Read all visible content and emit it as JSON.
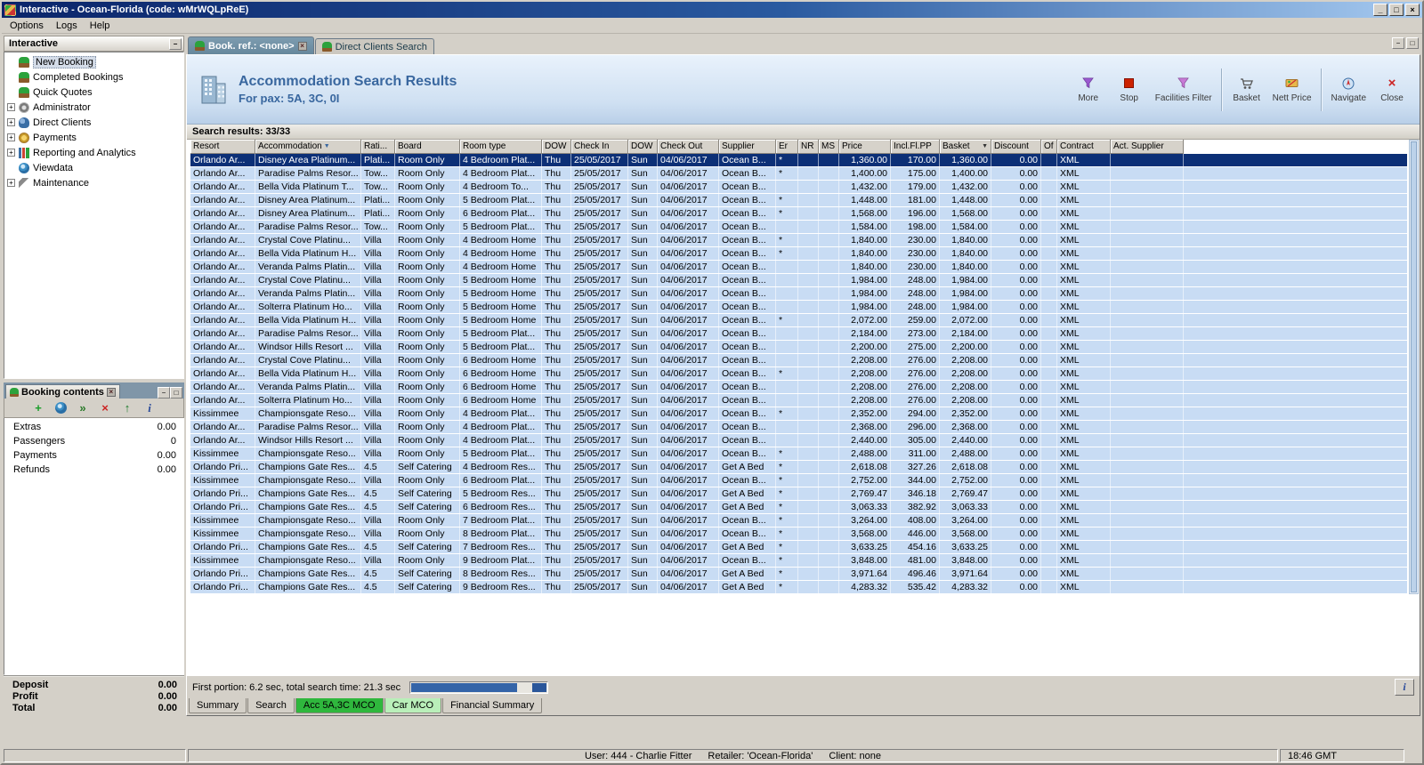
{
  "window": {
    "title": "Interactive - Ocean-Florida (code: wMrWQLpReE)",
    "menu": [
      "Options",
      "Logs",
      "Help"
    ],
    "buttons": {
      "minimize": "_",
      "maximize": "□",
      "close": "×"
    }
  },
  "sidebar": {
    "title": "Interactive",
    "items": [
      {
        "label": "New Booking",
        "icon": "palm-icon",
        "expandable": false,
        "selected": true
      },
      {
        "label": "Completed Bookings",
        "icon": "palm-icon",
        "expandable": false,
        "selected": false
      },
      {
        "label": "Quick Quotes",
        "icon": "palm-icon",
        "expandable": false,
        "selected": false
      },
      {
        "label": "Administrator",
        "icon": "gear-icon",
        "expandable": true,
        "selected": false
      },
      {
        "label": "Direct Clients",
        "icon": "people-icon",
        "expandable": true,
        "selected": false
      },
      {
        "label": "Payments",
        "icon": "coins-icon",
        "expandable": true,
        "selected": false
      },
      {
        "label": "Reporting and Analytics",
        "icon": "chart-icon",
        "expandable": true,
        "selected": false
      },
      {
        "label": "Viewdata",
        "icon": "globe-icon",
        "expandable": false,
        "selected": false
      },
      {
        "label": "Maintenance",
        "icon": "wrench-icon",
        "expandable": true,
        "selected": false
      }
    ]
  },
  "booking_contents": {
    "tab_title": "Booking contents",
    "toolbar_icons": [
      "add-icon",
      "globe-icon",
      "transfer-icon",
      "delete-icon",
      "upload-icon",
      "info-icon"
    ],
    "rows": [
      {
        "label": "Extras",
        "value": "0.00"
      },
      {
        "label": "Passengers",
        "value": "0"
      },
      {
        "label": "Payments",
        "value": "0.00"
      },
      {
        "label": "Refunds",
        "value": "0.00"
      }
    ],
    "totals": [
      {
        "label": "Deposit",
        "value": "0.00"
      },
      {
        "label": "Profit",
        "value": "0.00"
      },
      {
        "label": "Total",
        "value": "0.00"
      }
    ]
  },
  "main": {
    "tabs": [
      {
        "label": "Book. ref.: <none>",
        "active": true
      },
      {
        "label": "Direct Clients Search",
        "active": false
      }
    ],
    "header": {
      "title": "Accommodation Search Results",
      "subtitle": "For pax: 5A, 3C, 0I"
    },
    "toolbar": [
      {
        "label": "More"
      },
      {
        "label": "Stop"
      },
      {
        "label": "Facilities Filter"
      },
      {
        "label": "Basket"
      },
      {
        "label": "Nett Price"
      },
      {
        "label": "Navigate"
      },
      {
        "label": "Close"
      }
    ],
    "results_label": "Search results: 33/33",
    "table": {
      "columns": [
        "Resort",
        "Accommodation",
        "Rati...",
        "Board",
        "Room type",
        "DOW",
        "Check In",
        "DOW",
        "Check Out",
        "Supplier",
        "Er",
        "NR",
        "MS",
        "Price",
        "Incl.Fl.PP",
        "Basket",
        "Discount",
        "Of",
        "Contract",
        "Act. Supplier"
      ],
      "selected_row": 0,
      "rows": [
        [
          "Orlando Ar...",
          "Disney Area Platinum...",
          "Plati...",
          "Room Only",
          "4 Bedroom Plat...",
          "Thu",
          "25/05/2017",
          "Sun",
          "04/06/2017",
          "Ocean B...",
          "*",
          "",
          "",
          "1,360.00",
          "170.00",
          "1,360.00",
          "0.00",
          "",
          "XML",
          ""
        ],
        [
          "Orlando Ar...",
          "Paradise Palms Resor...",
          "Tow...",
          "Room Only",
          "4 Bedroom Plat...",
          "Thu",
          "25/05/2017",
          "Sun",
          "04/06/2017",
          "Ocean B...",
          "*",
          "",
          "",
          "1,400.00",
          "175.00",
          "1,400.00",
          "0.00",
          "",
          "XML",
          ""
        ],
        [
          "Orlando Ar...",
          "Bella Vida Platinum T...",
          "Tow...",
          "Room Only",
          "4 Bedroom To...",
          "Thu",
          "25/05/2017",
          "Sun",
          "04/06/2017",
          "Ocean B...",
          "",
          "",
          "",
          "1,432.00",
          "179.00",
          "1,432.00",
          "0.00",
          "",
          "XML",
          ""
        ],
        [
          "Orlando Ar...",
          "Disney Area Platinum...",
          "Plati...",
          "Room Only",
          "5 Bedroom Plat...",
          "Thu",
          "25/05/2017",
          "Sun",
          "04/06/2017",
          "Ocean B...",
          "*",
          "",
          "",
          "1,448.00",
          "181.00",
          "1,448.00",
          "0.00",
          "",
          "XML",
          ""
        ],
        [
          "Orlando Ar...",
          "Disney Area Platinum...",
          "Plati...",
          "Room Only",
          "6 Bedroom Plat...",
          "Thu",
          "25/05/2017",
          "Sun",
          "04/06/2017",
          "Ocean B...",
          "*",
          "",
          "",
          "1,568.00",
          "196.00",
          "1,568.00",
          "0.00",
          "",
          "XML",
          ""
        ],
        [
          "Orlando Ar...",
          "Paradise Palms Resor...",
          "Tow...",
          "Room Only",
          "5 Bedroom Plat...",
          "Thu",
          "25/05/2017",
          "Sun",
          "04/06/2017",
          "Ocean B...",
          "",
          "",
          "",
          "1,584.00",
          "198.00",
          "1,584.00",
          "0.00",
          "",
          "XML",
          ""
        ],
        [
          "Orlando Ar...",
          "Crystal Cove Platinu...",
          "Villa",
          "Room Only",
          "4 Bedroom Home",
          "Thu",
          "25/05/2017",
          "Sun",
          "04/06/2017",
          "Ocean B...",
          "*",
          "",
          "",
          "1,840.00",
          "230.00",
          "1,840.00",
          "0.00",
          "",
          "XML",
          ""
        ],
        [
          "Orlando Ar...",
          "Bella Vida Platinum H...",
          "Villa",
          "Room Only",
          "4 Bedroom Home",
          "Thu",
          "25/05/2017",
          "Sun",
          "04/06/2017",
          "Ocean B...",
          "*",
          "",
          "",
          "1,840.00",
          "230.00",
          "1,840.00",
          "0.00",
          "",
          "XML",
          ""
        ],
        [
          "Orlando Ar...",
          "Veranda Palms Platin...",
          "Villa",
          "Room Only",
          "4 Bedroom Home",
          "Thu",
          "25/05/2017",
          "Sun",
          "04/06/2017",
          "Ocean B...",
          "",
          "",
          "",
          "1,840.00",
          "230.00",
          "1,840.00",
          "0.00",
          "",
          "XML",
          ""
        ],
        [
          "Orlando Ar...",
          "Crystal Cove Platinu...",
          "Villa",
          "Room Only",
          "5 Bedroom Home",
          "Thu",
          "25/05/2017",
          "Sun",
          "04/06/2017",
          "Ocean B...",
          "",
          "",
          "",
          "1,984.00",
          "248.00",
          "1,984.00",
          "0.00",
          "",
          "XML",
          ""
        ],
        [
          "Orlando Ar...",
          "Veranda Palms Platin...",
          "Villa",
          "Room Only",
          "5 Bedroom Home",
          "Thu",
          "25/05/2017",
          "Sun",
          "04/06/2017",
          "Ocean B...",
          "",
          "",
          "",
          "1,984.00",
          "248.00",
          "1,984.00",
          "0.00",
          "",
          "XML",
          ""
        ],
        [
          "Orlando Ar...",
          "Solterra Platinum Ho...",
          "Villa",
          "Room Only",
          "5 Bedroom Home",
          "Thu",
          "25/05/2017",
          "Sun",
          "04/06/2017",
          "Ocean B...",
          "",
          "",
          "",
          "1,984.00",
          "248.00",
          "1,984.00",
          "0.00",
          "",
          "XML",
          ""
        ],
        [
          "Orlando Ar...",
          "Bella Vida Platinum H...",
          "Villa",
          "Room Only",
          "5 Bedroom Home",
          "Thu",
          "25/05/2017",
          "Sun",
          "04/06/2017",
          "Ocean B...",
          "*",
          "",
          "",
          "2,072.00",
          "259.00",
          "2,072.00",
          "0.00",
          "",
          "XML",
          ""
        ],
        [
          "Orlando Ar...",
          "Paradise Palms Resor...",
          "Villa",
          "Room Only",
          "5 Bedroom Plat...",
          "Thu",
          "25/05/2017",
          "Sun",
          "04/06/2017",
          "Ocean B...",
          "",
          "",
          "",
          "2,184.00",
          "273.00",
          "2,184.00",
          "0.00",
          "",
          "XML",
          ""
        ],
        [
          "Orlando Ar...",
          "Windsor Hills Resort ...",
          "Villa",
          "Room Only",
          "5 Bedroom Plat...",
          "Thu",
          "25/05/2017",
          "Sun",
          "04/06/2017",
          "Ocean B...",
          "",
          "",
          "",
          "2,200.00",
          "275.00",
          "2,200.00",
          "0.00",
          "",
          "XML",
          ""
        ],
        [
          "Orlando Ar...",
          "Crystal Cove Platinu...",
          "Villa",
          "Room Only",
          "6 Bedroom Home",
          "Thu",
          "25/05/2017",
          "Sun",
          "04/06/2017",
          "Ocean B...",
          "",
          "",
          "",
          "2,208.00",
          "276.00",
          "2,208.00",
          "0.00",
          "",
          "XML",
          ""
        ],
        [
          "Orlando Ar...",
          "Bella Vida Platinum H...",
          "Villa",
          "Room Only",
          "6 Bedroom Home",
          "Thu",
          "25/05/2017",
          "Sun",
          "04/06/2017",
          "Ocean B...",
          "*",
          "",
          "",
          "2,208.00",
          "276.00",
          "2,208.00",
          "0.00",
          "",
          "XML",
          ""
        ],
        [
          "Orlando Ar...",
          "Veranda Palms Platin...",
          "Villa",
          "Room Only",
          "6 Bedroom Home",
          "Thu",
          "25/05/2017",
          "Sun",
          "04/06/2017",
          "Ocean B...",
          "",
          "",
          "",
          "2,208.00",
          "276.00",
          "2,208.00",
          "0.00",
          "",
          "XML",
          ""
        ],
        [
          "Orlando Ar...",
          "Solterra Platinum Ho...",
          "Villa",
          "Room Only",
          "6 Bedroom Home",
          "Thu",
          "25/05/2017",
          "Sun",
          "04/06/2017",
          "Ocean B...",
          "",
          "",
          "",
          "2,208.00",
          "276.00",
          "2,208.00",
          "0.00",
          "",
          "XML",
          ""
        ],
        [
          "Kissimmee",
          "Championsgate Reso...",
          "Villa",
          "Room Only",
          "4 Bedroom Plat...",
          "Thu",
          "25/05/2017",
          "Sun",
          "04/06/2017",
          "Ocean B...",
          "*",
          "",
          "",
          "2,352.00",
          "294.00",
          "2,352.00",
          "0.00",
          "",
          "XML",
          ""
        ],
        [
          "Orlando Ar...",
          "Paradise Palms Resor...",
          "Villa",
          "Room Only",
          "4 Bedroom Plat...",
          "Thu",
          "25/05/2017",
          "Sun",
          "04/06/2017",
          "Ocean B...",
          "",
          "",
          "",
          "2,368.00",
          "296.00",
          "2,368.00",
          "0.00",
          "",
          "XML",
          ""
        ],
        [
          "Orlando Ar...",
          "Windsor Hills Resort ...",
          "Villa",
          "Room Only",
          "4 Bedroom Plat...",
          "Thu",
          "25/05/2017",
          "Sun",
          "04/06/2017",
          "Ocean B...",
          "",
          "",
          "",
          "2,440.00",
          "305.00",
          "2,440.00",
          "0.00",
          "",
          "XML",
          ""
        ],
        [
          "Kissimmee",
          "Championsgate Reso...",
          "Villa",
          "Room Only",
          "5 Bedroom Plat...",
          "Thu",
          "25/05/2017",
          "Sun",
          "04/06/2017",
          "Ocean B...",
          "*",
          "",
          "",
          "2,488.00",
          "311.00",
          "2,488.00",
          "0.00",
          "",
          "XML",
          ""
        ],
        [
          "Orlando Pri...",
          "Champions Gate Res...",
          "4.5",
          "Self Catering",
          "4 Bedroom Res...",
          "Thu",
          "25/05/2017",
          "Sun",
          "04/06/2017",
          "Get A Bed",
          "*",
          "",
          "",
          "2,618.08",
          "327.26",
          "2,618.08",
          "0.00",
          "",
          "XML",
          ""
        ],
        [
          "Kissimmee",
          "Championsgate Reso...",
          "Villa",
          "Room Only",
          "6 Bedroom Plat...",
          "Thu",
          "25/05/2017",
          "Sun",
          "04/06/2017",
          "Ocean B...",
          "*",
          "",
          "",
          "2,752.00",
          "344.00",
          "2,752.00",
          "0.00",
          "",
          "XML",
          ""
        ],
        [
          "Orlando Pri...",
          "Champions Gate Res...",
          "4.5",
          "Self Catering",
          "5 Bedroom Res...",
          "Thu",
          "25/05/2017",
          "Sun",
          "04/06/2017",
          "Get A Bed",
          "*",
          "",
          "",
          "2,769.47",
          "346.18",
          "2,769.47",
          "0.00",
          "",
          "XML",
          ""
        ],
        [
          "Orlando Pri...",
          "Champions Gate Res...",
          "4.5",
          "Self Catering",
          "6 Bedroom Res...",
          "Thu",
          "25/05/2017",
          "Sun",
          "04/06/2017",
          "Get A Bed",
          "*",
          "",
          "",
          "3,063.33",
          "382.92",
          "3,063.33",
          "0.00",
          "",
          "XML",
          ""
        ],
        [
          "Kissimmee",
          "Championsgate Reso...",
          "Villa",
          "Room Only",
          "7 Bedroom Plat...",
          "Thu",
          "25/05/2017",
          "Sun",
          "04/06/2017",
          "Ocean B...",
          "*",
          "",
          "",
          "3,264.00",
          "408.00",
          "3,264.00",
          "0.00",
          "",
          "XML",
          ""
        ],
        [
          "Kissimmee",
          "Championsgate Reso...",
          "Villa",
          "Room Only",
          "8 Bedroom Plat...",
          "Thu",
          "25/05/2017",
          "Sun",
          "04/06/2017",
          "Ocean B...",
          "*",
          "",
          "",
          "3,568.00",
          "446.00",
          "3,568.00",
          "0.00",
          "",
          "XML",
          ""
        ],
        [
          "Orlando Pri...",
          "Champions Gate Res...",
          "4.5",
          "Self Catering",
          "7 Bedroom Res...",
          "Thu",
          "25/05/2017",
          "Sun",
          "04/06/2017",
          "Get A Bed",
          "*",
          "",
          "",
          "3,633.25",
          "454.16",
          "3,633.25",
          "0.00",
          "",
          "XML",
          ""
        ],
        [
          "Kissimmee",
          "Championsgate Reso...",
          "Villa",
          "Room Only",
          "9 Bedroom Plat...",
          "Thu",
          "25/05/2017",
          "Sun",
          "04/06/2017",
          "Ocean B...",
          "*",
          "",
          "",
          "3,848.00",
          "481.00",
          "3,848.00",
          "0.00",
          "",
          "XML",
          ""
        ],
        [
          "Orlando Pri...",
          "Champions Gate Res...",
          "4.5",
          "Self Catering",
          "8 Bedroom Res...",
          "Thu",
          "25/05/2017",
          "Sun",
          "04/06/2017",
          "Get A Bed",
          "*",
          "",
          "",
          "3,971.64",
          "496.46",
          "3,971.64",
          "0.00",
          "",
          "XML",
          ""
        ],
        [
          "Orlando Pri...",
          "Champions Gate Res...",
          "4.5",
          "Self Catering",
          "9 Bedroom Res...",
          "Thu",
          "25/05/2017",
          "Sun",
          "04/06/2017",
          "Get A Bed",
          "*",
          "",
          "",
          "4,283.32",
          "535.42",
          "4,283.32",
          "0.00",
          "",
          "XML",
          ""
        ]
      ]
    },
    "status_text": "First portion: 6.2 sec, total search time: 21.3 sec",
    "progress_percent": 78,
    "info_button": "i",
    "bottom_tabs": [
      {
        "label": "Summary",
        "bg": ""
      },
      {
        "label": "Search",
        "bg": ""
      },
      {
        "label": "Acc 5A,3C MCO",
        "bg": "#2fb73d"
      },
      {
        "label": "Car MCO",
        "bg": "#b9efb9"
      },
      {
        "label": "Financial Summary",
        "bg": ""
      }
    ]
  },
  "statusbar": {
    "user": "User: 444 - Charlie Fitter",
    "retailer": "Retailer: 'Ocean-Florida'",
    "client": "Client: none",
    "time": "18:46 GMT"
  },
  "colors": {
    "row_bg": "#c8dcf4",
    "selected_row": "#0c2f76",
    "header_title": "#39679f",
    "tab_green": "#2fb73d",
    "tab_light_green": "#b9efb9"
  }
}
